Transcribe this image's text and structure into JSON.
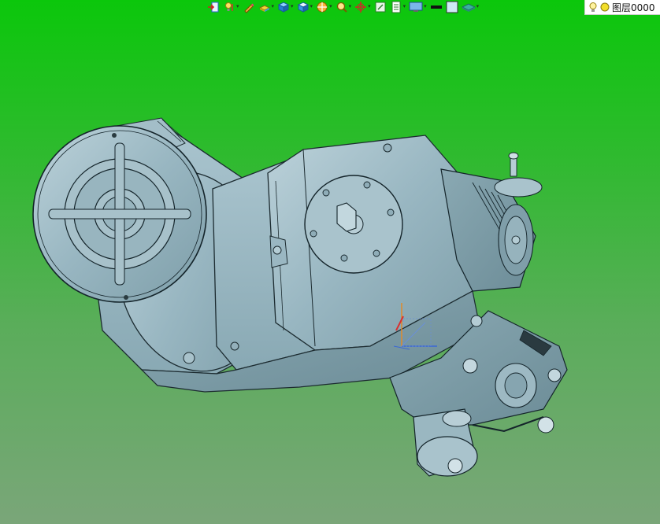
{
  "app": {
    "viewport_background": [
      "#0bc70b",
      "#7aa679"
    ],
    "part_color": "#9cbac5"
  },
  "toolbar": {
    "items": [
      {
        "icon": "exit-sketch-icon",
        "has_dropdown": false
      },
      {
        "icon": "light-bulb-icon",
        "has_dropdown": true
      },
      {
        "icon": "pencil-icon",
        "has_dropdown": false
      },
      {
        "icon": "view-orientation-icon",
        "has_dropdown": true
      },
      {
        "icon": "cube-view-icon",
        "has_dropdown": true
      },
      {
        "icon": "cube-render-icon",
        "has_dropdown": true
      },
      {
        "icon": "section-view-icon",
        "has_dropdown": true
      },
      {
        "icon": "zoom-icon",
        "has_dropdown": true
      },
      {
        "icon": "rotate-axis-icon",
        "has_dropdown": true
      },
      {
        "icon": "zoom-fit-icon",
        "has_dropdown": false
      },
      {
        "icon": "display-toggle-icon",
        "has_dropdown": true
      },
      {
        "icon": "monitor-icon",
        "has_dropdown": true
      },
      {
        "icon": "line-color-icon",
        "has_dropdown": false
      },
      {
        "icon": "fill-color-icon",
        "has_dropdown": false
      },
      {
        "icon": "layer-shape-icon",
        "has_dropdown": true
      }
    ]
  },
  "layer": {
    "label": "图层0000",
    "icons": [
      "bulb-icon",
      "circle-icon"
    ]
  },
  "triad": {
    "axes": [
      "x",
      "y",
      "z"
    ]
  }
}
